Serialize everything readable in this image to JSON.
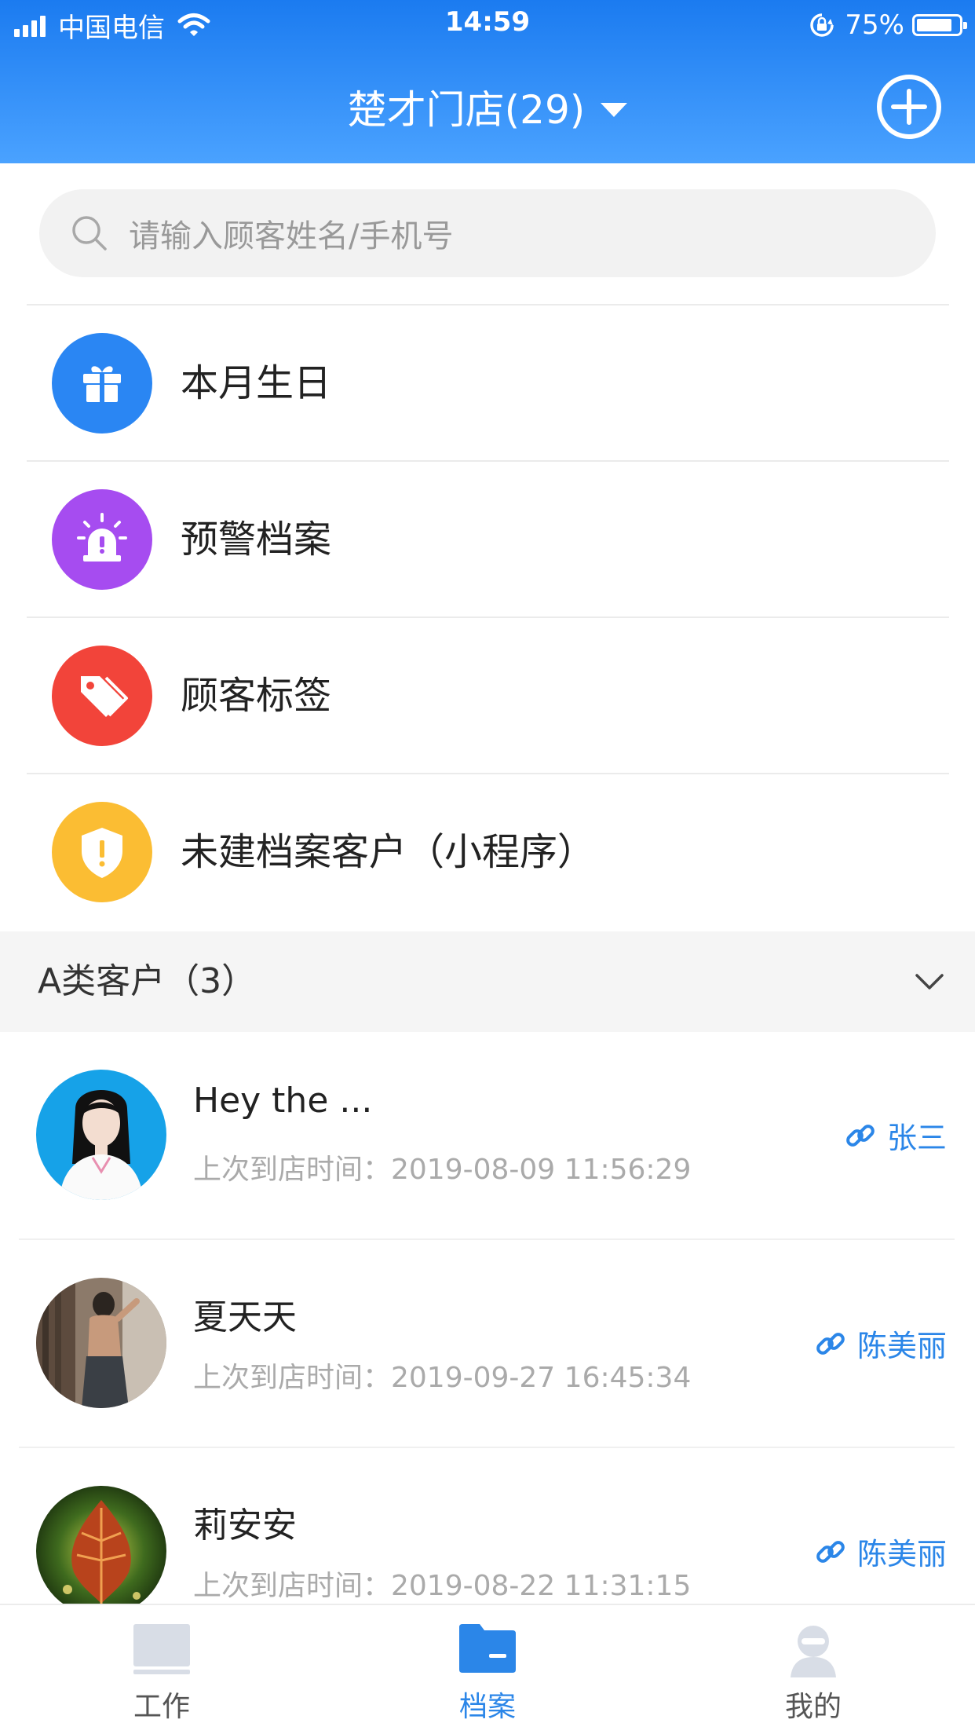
{
  "status_bar": {
    "carrier": "中国电信",
    "time": "14:59",
    "battery": "75%"
  },
  "header": {
    "store_title": "楚才门店(29)"
  },
  "search": {
    "placeholder": "请输入顾客姓名/手机号"
  },
  "menu": [
    {
      "label": "本月生日",
      "icon": "gift-icon",
      "color": "#2a86f3"
    },
    {
      "label": "预警档案",
      "icon": "alarm-icon",
      "color": "#a64cf0"
    },
    {
      "label": "顾客标签",
      "icon": "tag-icon",
      "color": "#f2443a"
    },
    {
      "label": "未建档案客户（小程序）",
      "icon": "shield-icon",
      "color": "#fbbd33"
    }
  ],
  "section": {
    "title": "A类客户（3）"
  },
  "customers": [
    {
      "name": "Hey the ...",
      "time": "上次到店时间：2019-08-09 11:56:29",
      "staff": "张三"
    },
    {
      "name": "夏天天",
      "time": "上次到店时间：2019-09-27 16:45:34",
      "staff": "陈美丽"
    },
    {
      "name": "莉安安",
      "time": "上次到店时间：2019-08-22 11:31:15",
      "staff": "陈美丽"
    }
  ],
  "tabs": [
    {
      "label": "工作",
      "icon": "monitor-icon",
      "active": false
    },
    {
      "label": "档案",
      "icon": "folder-icon",
      "active": true
    },
    {
      "label": "我的",
      "icon": "user-icon",
      "active": false
    }
  ],
  "colors": {
    "accent": "#2b86e8",
    "header_top": "#1b7bf0",
    "header_bottom": "#4aa2ff"
  }
}
